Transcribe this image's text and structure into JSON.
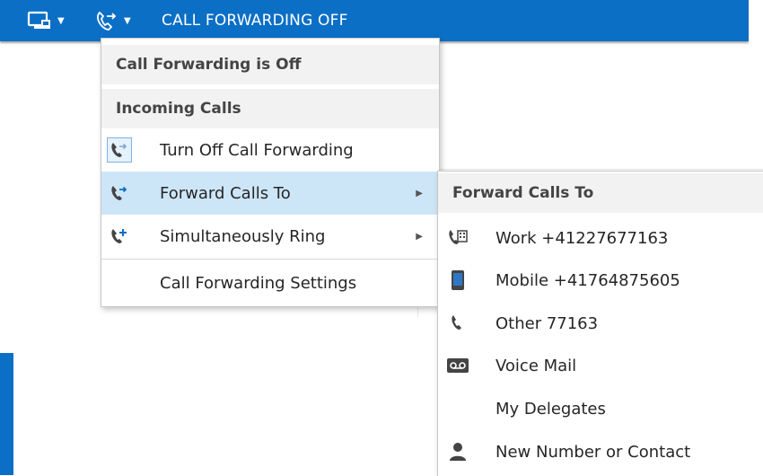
{
  "topbar": {
    "status_label": "CALL FORWARDING OFF",
    "icons": [
      "presence-display-icon",
      "call-forwarding-icon"
    ],
    "accent_color": "#0b6fc6"
  },
  "main_menu": {
    "header_status": "Call Forwarding is Off",
    "section_incoming": "Incoming Calls",
    "items": [
      {
        "label": "Turn Off Call Forwarding",
        "icon": "phone-forward-icon",
        "has_submenu": false,
        "selected": true
      },
      {
        "label": "Forward Calls To",
        "icon": "phone-forward-icon",
        "has_submenu": true,
        "highlighted": true
      },
      {
        "label": "Simultaneously Ring",
        "icon": "phone-plus-icon",
        "has_submenu": true
      },
      {
        "label": "Call Forwarding Settings",
        "icon": "",
        "has_submenu": false
      }
    ]
  },
  "submenu": {
    "header": "Forward Calls To",
    "items": [
      {
        "label": "Work +41227677163",
        "icon": "desk-phone-icon"
      },
      {
        "label": "Mobile +41764875605",
        "icon": "mobile-phone-icon"
      },
      {
        "label": "Other 77163",
        "icon": "phone-icon"
      },
      {
        "label": "Voice Mail",
        "icon": "voicemail-icon"
      },
      {
        "label": "My Delegates",
        "icon": ""
      },
      {
        "label": "New Number or Contact",
        "icon": "person-icon"
      }
    ]
  }
}
